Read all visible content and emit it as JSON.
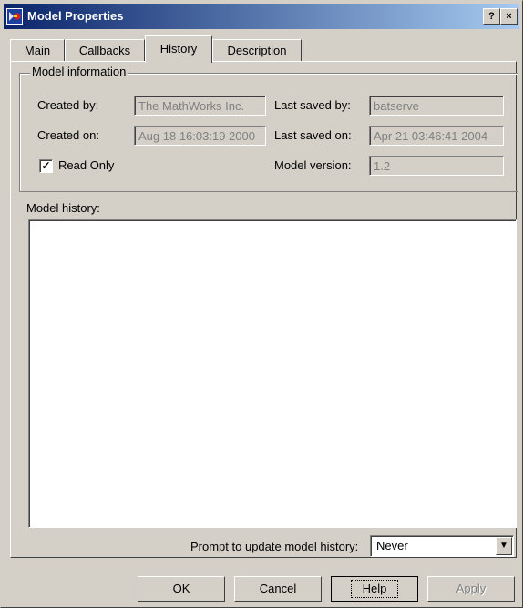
{
  "window": {
    "title": "Model Properties",
    "help_glyph": "?",
    "close_glyph": "×"
  },
  "tabs": [
    {
      "label": "Main",
      "active": false
    },
    {
      "label": "Callbacks",
      "active": false
    },
    {
      "label": "History",
      "active": true
    },
    {
      "label": "Description",
      "active": false
    }
  ],
  "model_info": {
    "legend": "Model information",
    "created_by_label": "Created by:",
    "created_by_value": "The MathWorks Inc.",
    "created_on_label": "Created on:",
    "created_on_value": "Aug 18 16:03:19 2000",
    "last_saved_by_label": "Last saved by:",
    "last_saved_by_value": "batserve",
    "last_saved_on_label": "Last saved on:",
    "last_saved_on_value": "Apr 21 03:46:41 2004",
    "model_version_label": "Model version:",
    "model_version_value": "1.2",
    "read_only_label": "Read Only",
    "read_only_checked": true,
    "check_glyph": "✓"
  },
  "history": {
    "label": "Model history:",
    "content": ""
  },
  "prompt": {
    "label": "Prompt to update model history:",
    "selected": "Never"
  },
  "buttons": {
    "ok": "OK",
    "cancel": "Cancel",
    "help": "Help",
    "apply": "Apply"
  }
}
